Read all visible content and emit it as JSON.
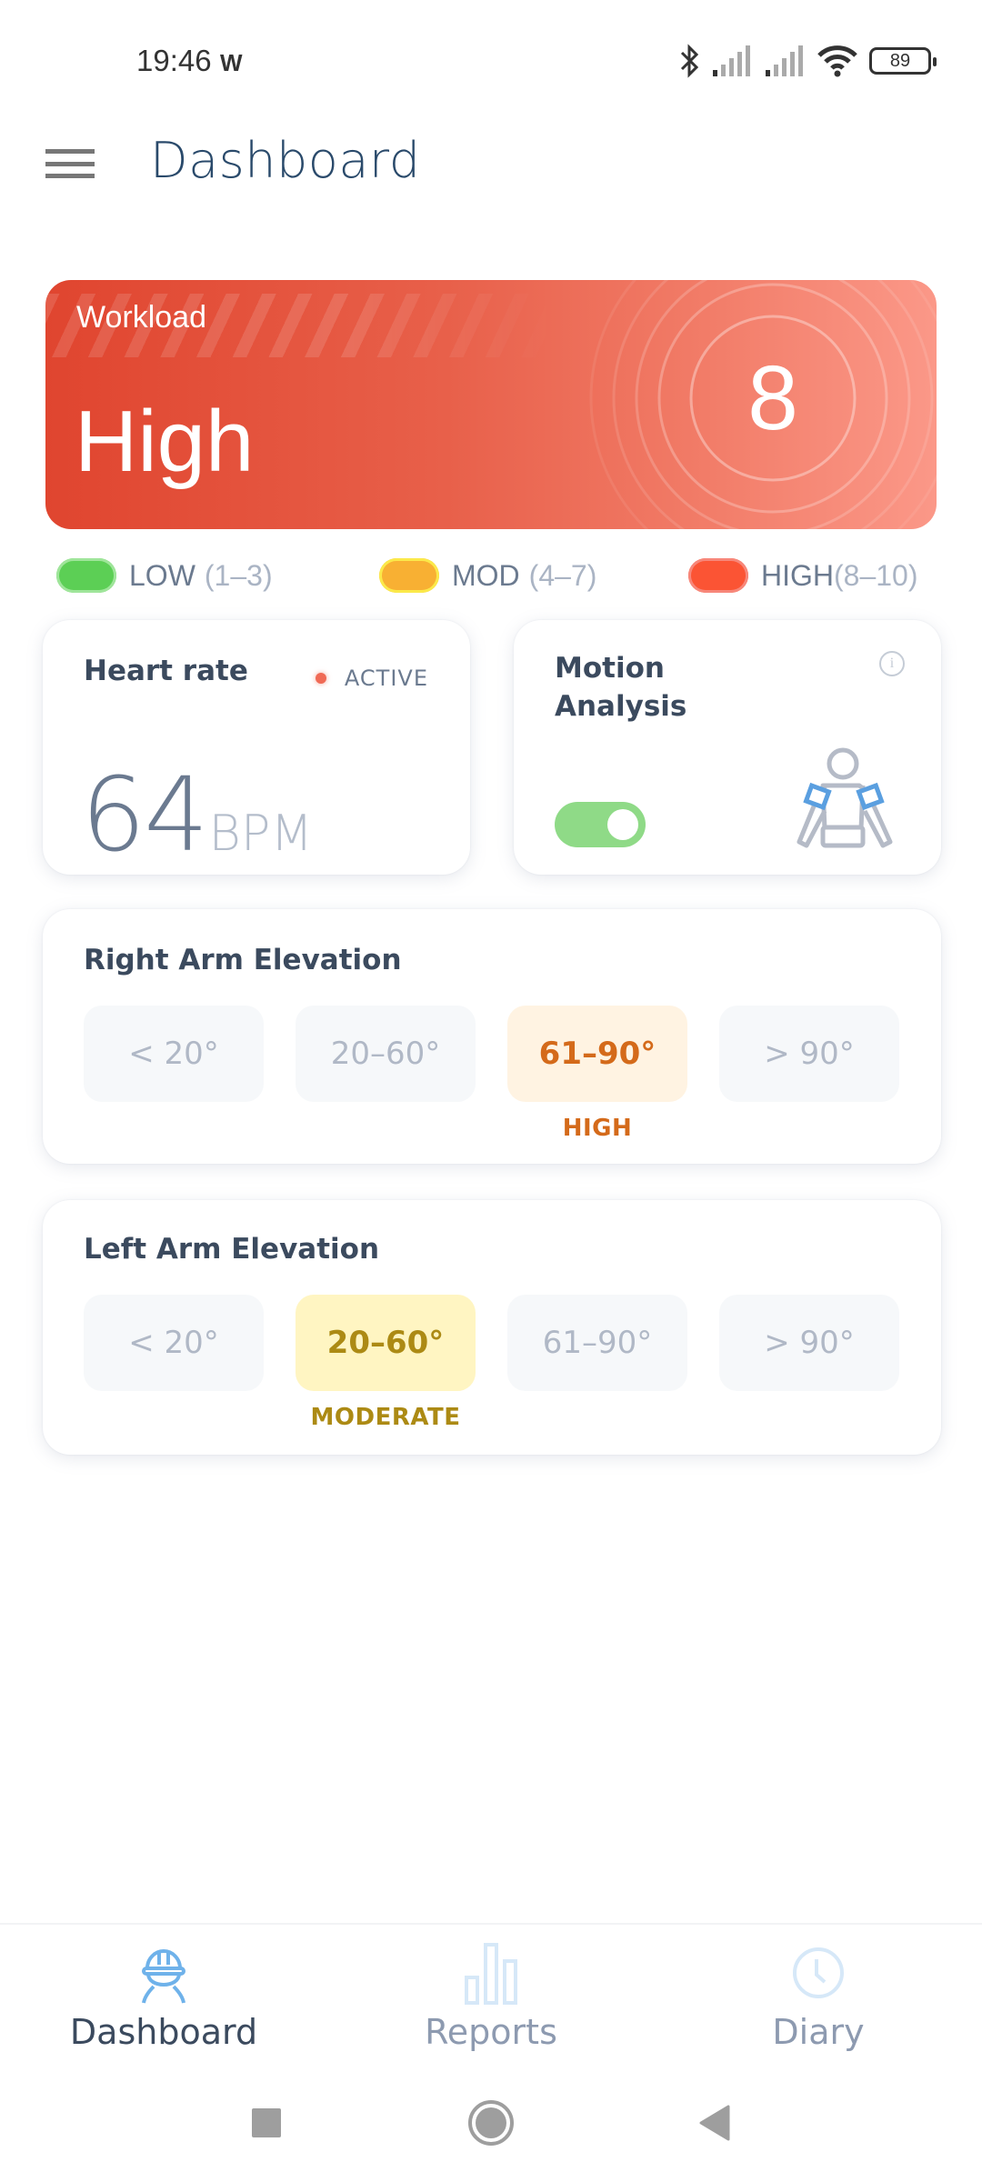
{
  "status_bar": {
    "time": "19:46",
    "app_indicator": "W",
    "battery": "89",
    "icons": [
      "bluetooth-icon",
      "signal-icon",
      "signal-icon",
      "wifi-icon",
      "battery-icon"
    ]
  },
  "header": {
    "title": "Dashboard",
    "menu_icon": "hamburger-menu-icon"
  },
  "workload": {
    "label": "Workload",
    "level": "High",
    "score": "8",
    "colors": {
      "from": "#e0452f",
      "to": "#fb9888"
    }
  },
  "legend": [
    {
      "name": "LOW",
      "range": "(1–3)",
      "color": "#5ccf55"
    },
    {
      "name": "MOD",
      "range": "(4–7)",
      "color": "#f8b033"
    },
    {
      "name": "HIGH",
      "range": "(8–10)",
      "color": "#fb5434"
    }
  ],
  "heart_rate": {
    "title": "Heart rate",
    "status": "ACTIVE",
    "value": "64",
    "unit": "BPM"
  },
  "motion_analysis": {
    "title_line1": "Motion",
    "title_line2": "Analysis",
    "enabled": true,
    "info_icon": "info-icon",
    "figure_icon": "body-sensor-figure-icon"
  },
  "right_arm": {
    "title": "Right Arm Elevation",
    "ranges": [
      "< 20°",
      "20–60°",
      "61–90°",
      "> 90°"
    ],
    "active_index": 2,
    "active_label": "HIGH",
    "active_color": "#d46a1a",
    "active_bg": "#fff3e2"
  },
  "left_arm": {
    "title": "Left Arm Elevation",
    "ranges": [
      "< 20°",
      "20–60°",
      "61–90°",
      "> 90°"
    ],
    "active_index": 1,
    "active_label": "MODERATE",
    "active_color": "#ac8a14",
    "active_bg": "#fff5c2"
  },
  "bottom_nav": {
    "items": [
      {
        "label": "Dashboard",
        "icon": "worker-helmet-icon",
        "active": true
      },
      {
        "label": "Reports",
        "icon": "bar-chart-icon",
        "active": false
      },
      {
        "label": "Diary",
        "icon": "clock-icon",
        "active": false
      }
    ]
  },
  "system_nav": {
    "recents": "recents-square-icon",
    "home": "home-circle-icon",
    "back": "back-triangle-icon"
  }
}
